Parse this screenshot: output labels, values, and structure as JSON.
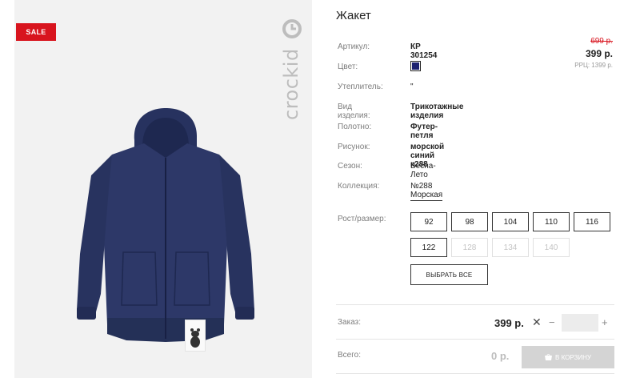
{
  "badge": {
    "label": "SALE"
  },
  "brand": {
    "logo_text": "crockid"
  },
  "product": {
    "title": "Жакет"
  },
  "attributes": [
    {
      "label": "Артикул:",
      "value": "КР 301254",
      "style": "bold"
    },
    {
      "label": "Цвет:",
      "value": "",
      "style": "swatch"
    },
    {
      "label": "Утеплитель:",
      "value": "\"",
      "style": "plain"
    },
    {
      "label": "Вид изделия:",
      "value": "Трикотажные изделия",
      "style": "bold"
    },
    {
      "label": "Полотно:",
      "value": "Футер-петля",
      "style": "bold"
    },
    {
      "label": "Рисунок:",
      "value": "морской синий к288",
      "style": "bold"
    },
    {
      "label": "Сезон:",
      "value": "Весна-Лето",
      "style": "plain"
    },
    {
      "label": "Коллекция:",
      "value": "№288 Морская",
      "style": "link"
    }
  ],
  "colors": {
    "swatch": "#1c2170",
    "sale": "#d8141e",
    "jacket": "#2a3566"
  },
  "price": {
    "old": "699 р.",
    "current": "399 р.",
    "rrp": "РРЦ: 1399 р."
  },
  "sizes": {
    "label": "Рост/размер:",
    "options": [
      {
        "label": "92",
        "available": true
      },
      {
        "label": "98",
        "available": true
      },
      {
        "label": "104",
        "available": true
      },
      {
        "label": "110",
        "available": true
      },
      {
        "label": "116",
        "available": true
      },
      {
        "label": "122",
        "available": true
      },
      {
        "label": "128",
        "available": false
      },
      {
        "label": "134",
        "available": false
      },
      {
        "label": "140",
        "available": false
      }
    ],
    "select_all": "ВЫБРАТЬ ВСЕ"
  },
  "order": {
    "label": "Заказ:",
    "price": "399 р.",
    "times": "✕",
    "minus": "−",
    "plus": "+",
    "quantity": ""
  },
  "total": {
    "label": "Всего:",
    "value": "0 р.",
    "cart_button": "В КОРЗИНУ"
  }
}
